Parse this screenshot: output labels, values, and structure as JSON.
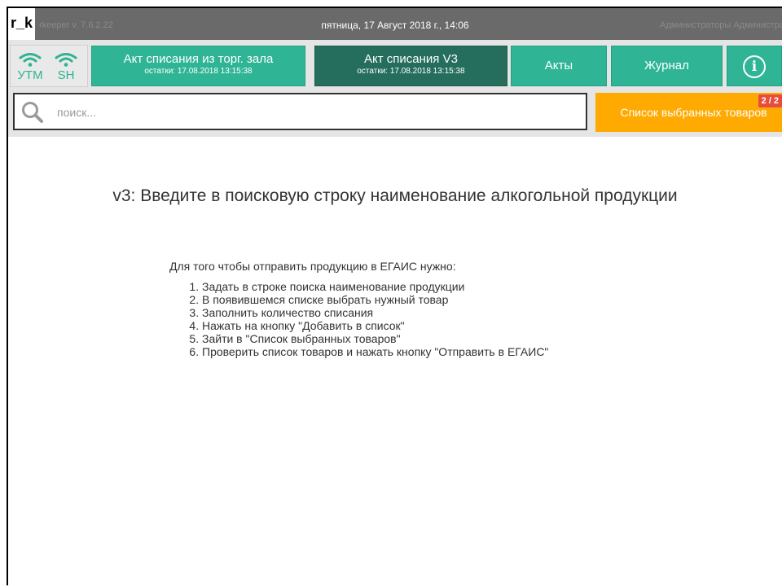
{
  "titlebar": {
    "logo": "r_k",
    "version": "rkeeper v. 7.6.2.22",
    "datetime": "пятница, 17 Август 2018 г., 14:06",
    "user": "Администраторы Администратор"
  },
  "status": {
    "utm_label": "УТМ",
    "sh_label": "SH",
    "color": "#2db392"
  },
  "toolbar": {
    "act_hall": {
      "title": "Акт списания из торг. зала",
      "sub": "остатки: 17.08.2018 13:15:38"
    },
    "act_v3": {
      "title": "Акт списания V3",
      "sub": "остатки: 17.08.2018 13:15:38"
    },
    "acts": "Акты",
    "journal": "Журнал",
    "info": "i"
  },
  "search": {
    "placeholder": "поиск...",
    "value": ""
  },
  "selected": {
    "label": "Список выбранных товаров",
    "badge": "2 / 2"
  },
  "content": {
    "headline": "v3: Введите в поисковую строку наименование алкогольной продукции",
    "intro": "Для того чтобы отправить продукцию в ЕГАИС нужно:",
    "steps": [
      "Задать в строке поиска наименование продукции",
      "В появившемся списке выбрать нужный товар",
      "Заполнить количество списания",
      "Нажать на кнопку \"Добавить в список\"",
      "Зайти в \"Список выбранных товаров\"",
      "Проверить список товаров и нажать кнопку \"Отправить в ЕГАИС\""
    ]
  },
  "colors": {
    "accent": "#2fb595",
    "accent_dark": "#256e5d",
    "orange": "#ffaa00",
    "badge": "#e74c3c"
  }
}
